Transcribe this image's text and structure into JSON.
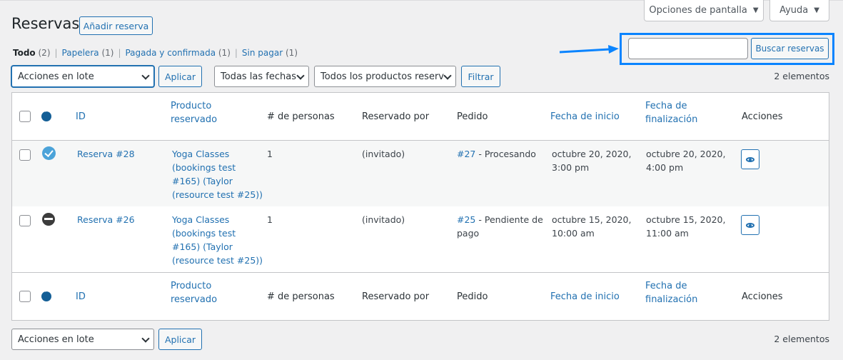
{
  "header": {
    "title": "Reservas",
    "add_label": "Añadir reserva",
    "screen_options": "Opciones de pantalla",
    "help": "Ayuda"
  },
  "views": [
    {
      "label": "Todo",
      "count": "(2)"
    },
    {
      "label": "Papelera",
      "count": "(1)"
    },
    {
      "label": "Pagada y confirmada",
      "count": "(1)"
    },
    {
      "label": "Sin pagar",
      "count": "(1)"
    }
  ],
  "search": {
    "placeholder": "",
    "button": "Buscar reservas"
  },
  "tablenav_top": {
    "bulk_action": "Acciones en lote",
    "apply": "Aplicar",
    "date_filter": "Todas las fechas",
    "product_filter": "Todos los productos reserv",
    "filter": "Filtrar",
    "count": "2 elementos"
  },
  "tablenav_bottom": {
    "bulk_action": "Acciones en lote",
    "apply": "Aplicar",
    "count": "2 elementos"
  },
  "columns": {
    "id": "ID",
    "product_line1": "Producto",
    "product_line2": "reservado",
    "persons": "# de personas",
    "booked_by": "Reservado por",
    "order": "Pedido",
    "start": "Fecha de inicio",
    "end_line1": "Fecha de",
    "end_line2": "finalización",
    "actions": "Acciones"
  },
  "rows": [
    {
      "id": "Reserva #28",
      "status_icon": "confirmed-check-icon",
      "product": [
        "Yoga Classes",
        "(bookings test",
        "#165) (Taylor",
        "(resource test #25))"
      ],
      "persons": "1",
      "booked_by": "(invitado)",
      "order_link": "#27",
      "order_status": [
        "- Procesando",
        ""
      ],
      "start": [
        "octubre 20, 2020,",
        "3:00 pm"
      ],
      "end": [
        "octubre 20, 2020,",
        "4:00 pm"
      ]
    },
    {
      "id": "Reserva #26",
      "status_icon": "unpaid-minus-icon",
      "product": [
        "Yoga Classes",
        "(bookings test",
        "#165) (Taylor",
        "(resource test #25))"
      ],
      "persons": "1",
      "booked_by": "(invitado)",
      "order_link": "#25",
      "order_status": [
        "- Pendiente de",
        "pago"
      ],
      "start": [
        "octubre 15, 2020,",
        "10:00 am"
      ],
      "end": [
        "octubre 15, 2020,",
        "11:00 am"
      ]
    }
  ],
  "colors": {
    "accent": "#2271b1",
    "highlight": "#0a84ff"
  }
}
